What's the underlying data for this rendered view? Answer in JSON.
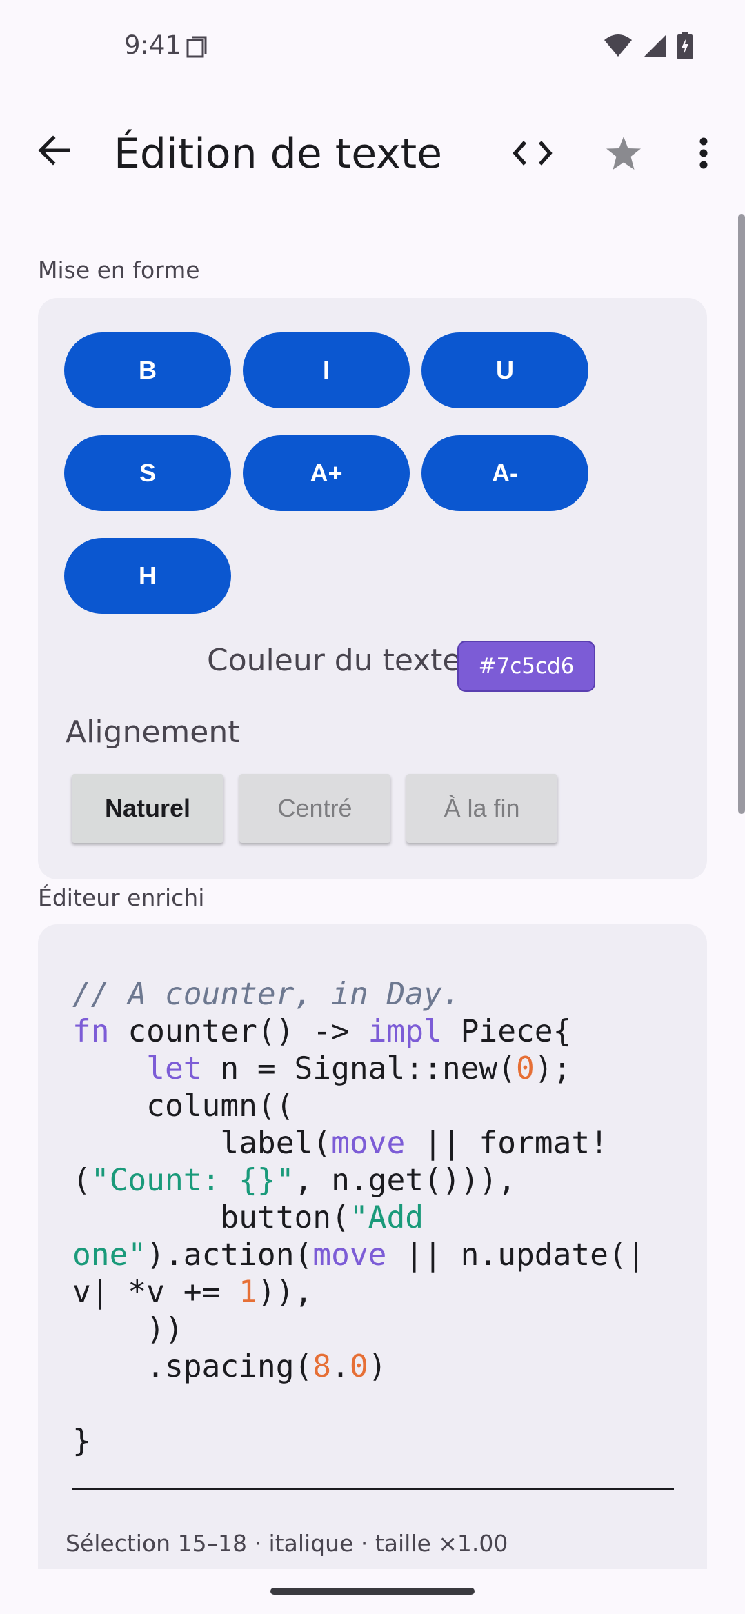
{
  "status": {
    "time": "9:41",
    "icons": [
      "sim-card-icon",
      "wifi-icon",
      "signal-icon",
      "battery-charging-icon"
    ]
  },
  "appbar": {
    "title": "Édition de texte",
    "icons": [
      "back-arrow-icon",
      "code-icon",
      "star-icon",
      "more-vert-icon"
    ],
    "star_color": "#8a8a8f"
  },
  "formatting": {
    "section_label": "Mise en forme",
    "buttons": [
      "B",
      "I",
      "U",
      "S",
      "A+",
      "A-",
      "H"
    ],
    "button_color": "#0b57d0",
    "text_color_label": "Couleur du texte",
    "text_color_value": "#7c5cd6",
    "alignment_label": "Alignement",
    "alignment_options": [
      "Naturel",
      "Centré",
      "À la fin"
    ],
    "alignment_selected": "Naturel"
  },
  "editor": {
    "section_label": "Éditeur enrichi",
    "code_lines": [
      [
        {
          "t": "// A counter, in Day.",
          "c": "comment"
        }
      ],
      [
        {
          "t": "fn",
          "c": "kw"
        },
        {
          "t": " counter() -> "
        },
        {
          "t": "impl",
          "c": "kw"
        },
        {
          "t": " Piece{"
        }
      ],
      [
        {
          "t": "    "
        },
        {
          "t": "let",
          "c": "kw"
        },
        {
          "t": " n = Signal::new("
        },
        {
          "t": "0",
          "c": "num"
        },
        {
          "t": ");"
        }
      ],
      [
        {
          "t": "    column(("
        }
      ],
      [
        {
          "t": "        label("
        },
        {
          "t": "move",
          "c": "kw"
        },
        {
          "t": " || format!"
        }
      ],
      [
        {
          "t": "("
        },
        {
          "t": "\"Count: {}\"",
          "c": "str"
        },
        {
          "t": ", n.get())),"
        }
      ],
      [
        {
          "t": "        button("
        },
        {
          "t": "\"Add",
          "c": "str"
        }
      ],
      [
        {
          "t": "one\"",
          "c": "str"
        },
        {
          "t": ").action("
        },
        {
          "t": "move",
          "c": "kw"
        },
        {
          "t": " || n.update(|"
        }
      ],
      [
        {
          "t": "v| *v += "
        },
        {
          "t": "1",
          "c": "num"
        },
        {
          "t": ")),"
        }
      ],
      [
        {
          "t": "    ))"
        }
      ],
      [
        {
          "t": "    .spacing("
        },
        {
          "t": "8",
          "c": "num"
        },
        {
          "t": "."
        },
        {
          "t": "0",
          "c": "num"
        },
        {
          "t": ")"
        }
      ],
      [
        {
          "t": ""
        }
      ],
      [
        {
          "t": "}"
        }
      ]
    ],
    "selection_info": "Sélection 15–18 · italique · taille ×1.00"
  }
}
